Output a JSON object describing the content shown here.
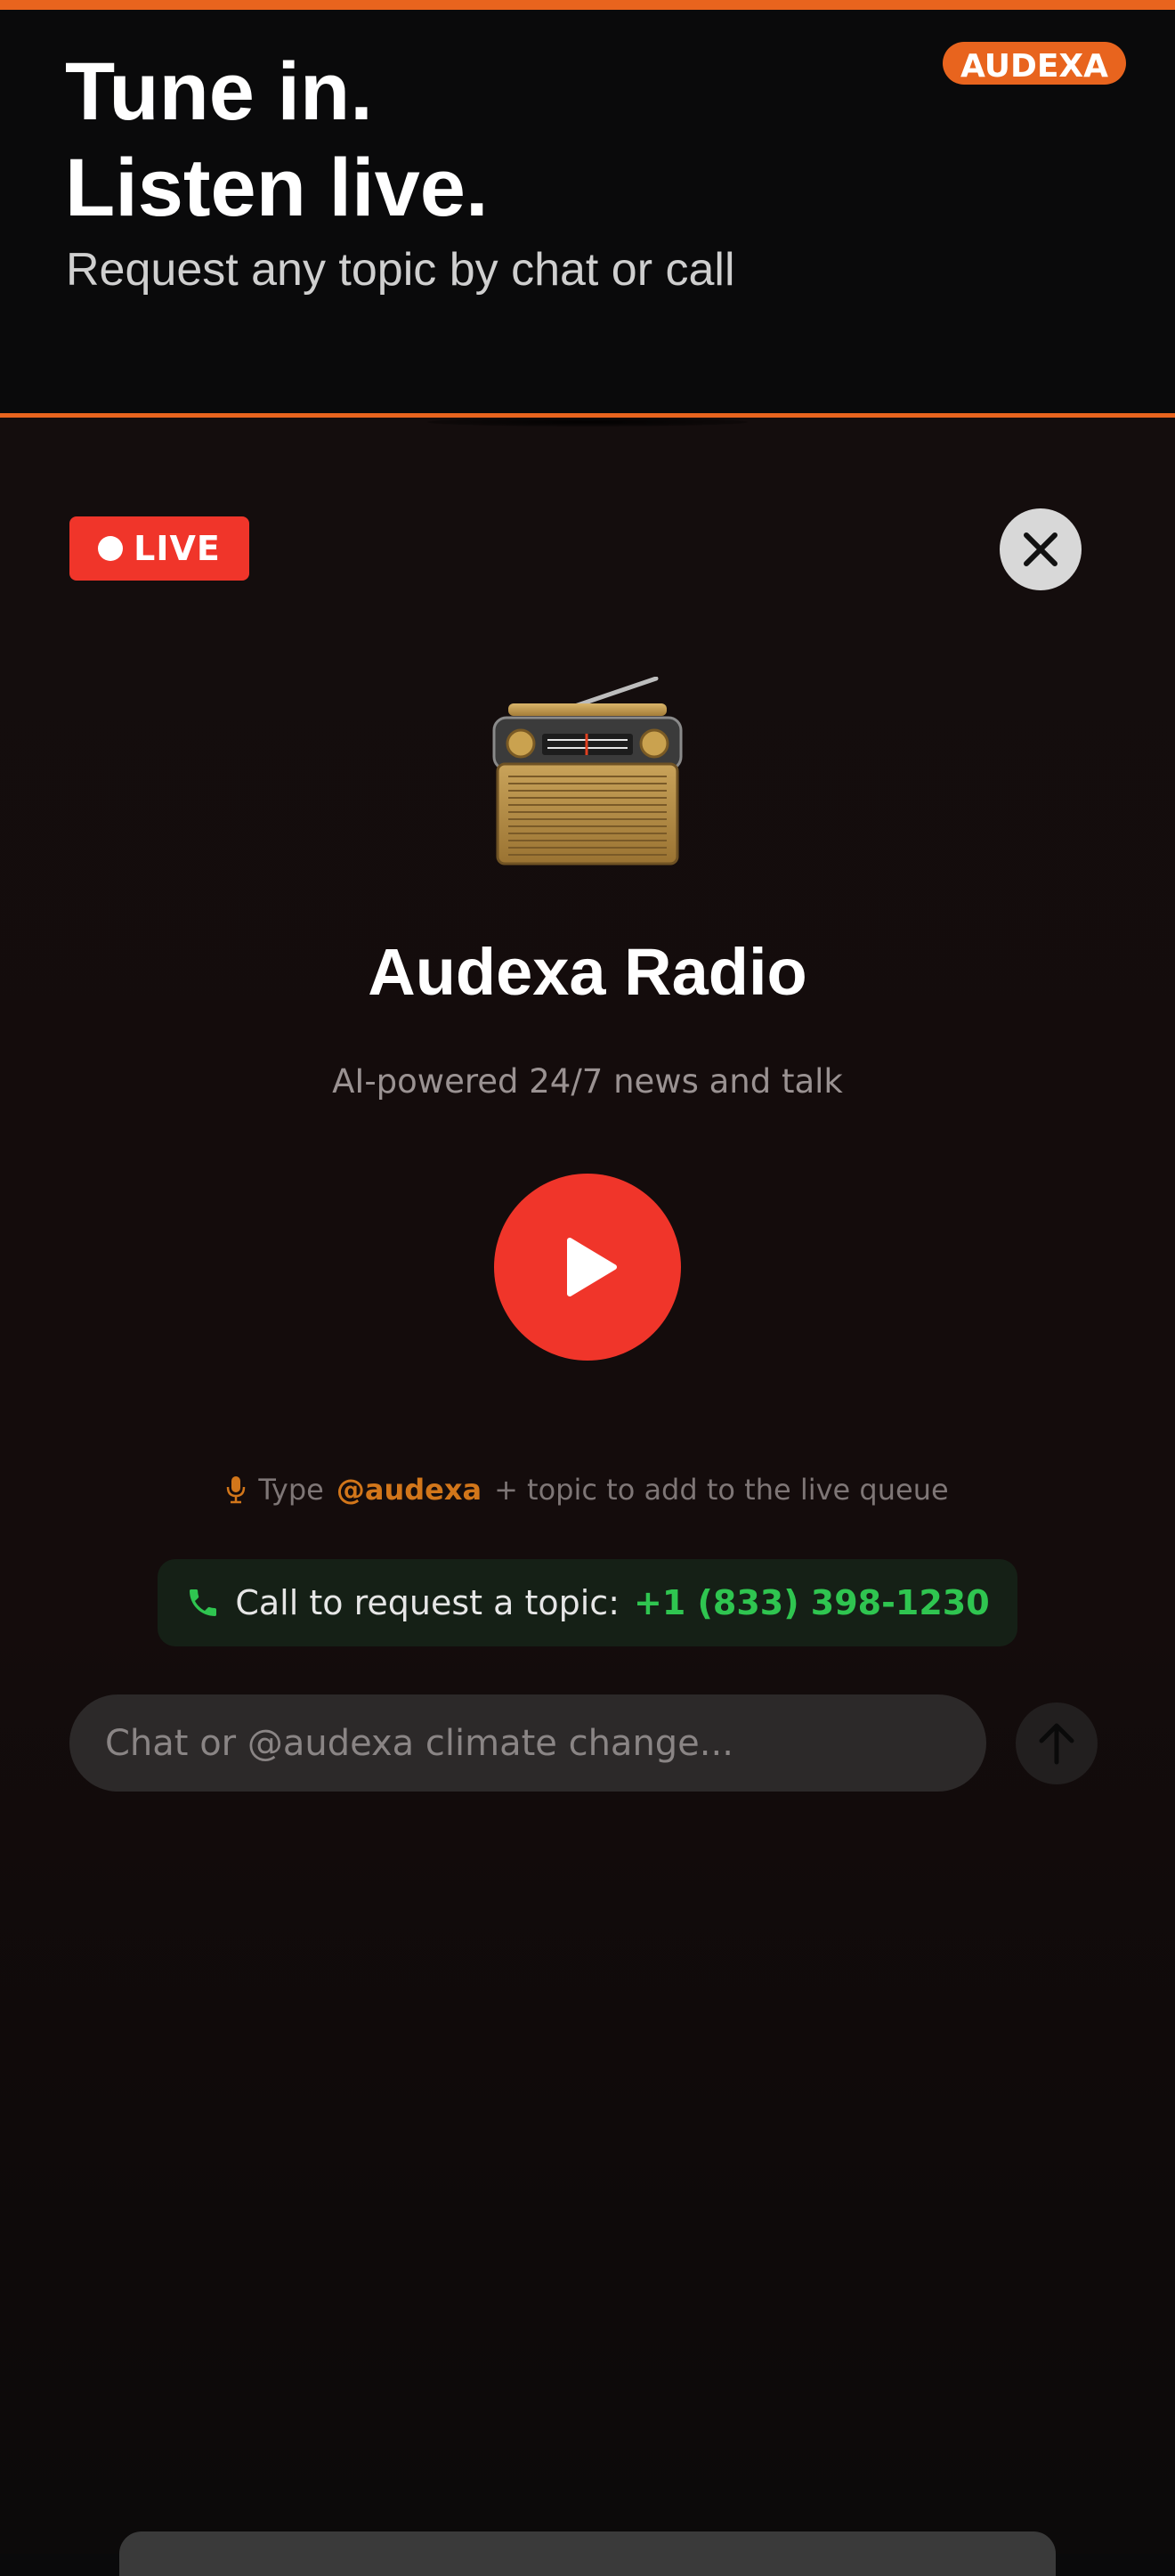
{
  "header": {
    "headline_line1": "Tune in.",
    "headline_line2": "Listen live.",
    "subline": "Request any topic by chat or call",
    "brand_badge": "AUDEXA"
  },
  "player": {
    "live_label": "LIVE",
    "station_icon": "radio-icon",
    "station_name": "Audexa Radio",
    "tagline": "AI-powered 24/7 news and talk",
    "hint": {
      "prefix": "Type",
      "mention": "@audexa",
      "suffix": "+ topic to add to the live queue"
    },
    "call": {
      "label": "Call to request a topic:",
      "number": "+1 (833) 398-1230"
    },
    "chat": {
      "placeholder": "Chat or @audexa climate change...",
      "value": ""
    }
  },
  "colors": {
    "accent": "#e8641e",
    "live_red": "#f0352a",
    "call_green": "#2fc550",
    "mention_orange": "#d2761a"
  }
}
